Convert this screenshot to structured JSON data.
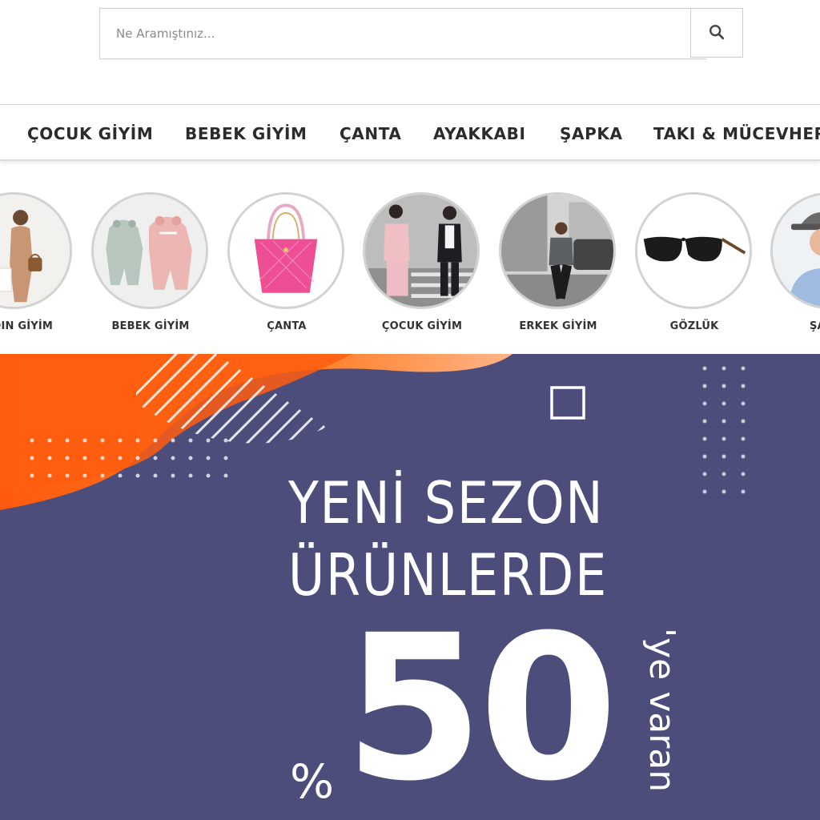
{
  "search": {
    "placeholder": "Ne Aramıştınız...",
    "value": ""
  },
  "nav": {
    "items": [
      {
        "label": "ÇOCUK GİYİM"
      },
      {
        "label": "BEBEK GİYİM"
      },
      {
        "label": "ÇANTA"
      },
      {
        "label": "AYAKKABI"
      },
      {
        "label": "ŞAPKA"
      },
      {
        "label": "TAKI & MÜCEVHER"
      }
    ]
  },
  "circle_categories": [
    {
      "label": "KADIN GİYİM"
    },
    {
      "label": "BEBEK GİYİM"
    },
    {
      "label": "ÇANTA"
    },
    {
      "label": "ÇOCUK GİYİM"
    },
    {
      "label": "ERKEK GİYİM"
    },
    {
      "label": "GÖZLÜK"
    },
    {
      "label": "ŞAPKA"
    }
  ],
  "banner": {
    "line1": "YENİ SEZON",
    "line2": "ÜRÜNLERDE",
    "percent_sign": "%",
    "number": "50",
    "suffix": "'ye varan",
    "colors": {
      "background": "#4c4d7a",
      "accent": "#ff6a13"
    }
  },
  "icons": {
    "search_button": "search-icon"
  }
}
